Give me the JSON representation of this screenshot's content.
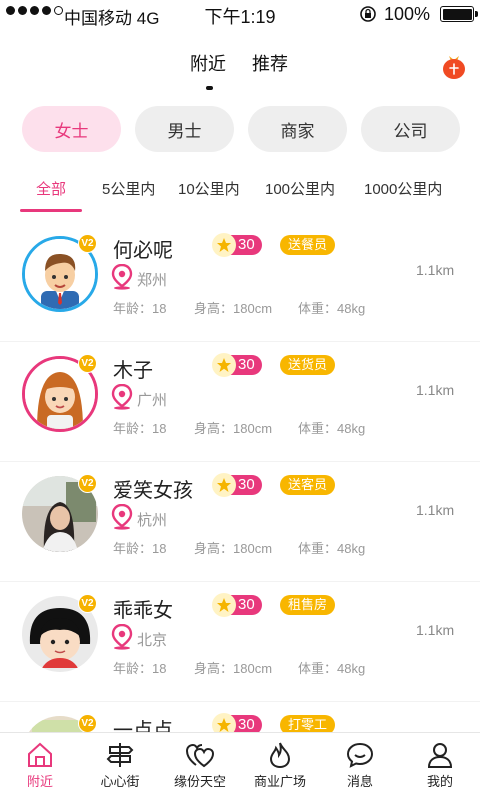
{
  "status_bar": {
    "carrier": "中国移动",
    "network": "4G",
    "time": "下午1:19",
    "battery": "100%",
    "signal_level": 4
  },
  "top_nav": {
    "tabs": [
      {
        "label": "附近",
        "active": true
      },
      {
        "label": "推荐",
        "active": false
      }
    ],
    "action_icon": "red-envelope-bag-icon"
  },
  "gender_filter": [
    {
      "label": "女士",
      "active": true
    },
    {
      "label": "男士",
      "active": false
    },
    {
      "label": "商家",
      "active": false
    },
    {
      "label": "公司",
      "active": false
    }
  ],
  "distance_filter": [
    {
      "label": "全部",
      "active": true
    },
    {
      "label": "5公里内",
      "active": false
    },
    {
      "label": "10公里内",
      "active": false
    },
    {
      "label": "100公里内",
      "active": false
    },
    {
      "label": "1000公里内",
      "active": false
    }
  ],
  "meta_labels": {
    "age": "年龄：",
    "height": "身高：",
    "weight": "体重："
  },
  "users": [
    {
      "name": "何必呢",
      "level": "V2",
      "score": "30",
      "job": "送餐员",
      "city": "郑州",
      "age": "18",
      "height": "180cm",
      "weight": "48kg",
      "distance": "1.1km",
      "avatar": "cartoon-man-avatar"
    },
    {
      "name": "木子",
      "level": "V2",
      "score": "30",
      "job": "送货员",
      "city": "广州",
      "age": "18",
      "height": "180cm",
      "weight": "48kg",
      "distance": "1.1km",
      "avatar": "cartoon-girl-avatar"
    },
    {
      "name": "爱笑女孩",
      "level": "V2",
      "score": "30",
      "job": "送客员",
      "city": "杭州",
      "age": "18",
      "height": "180cm",
      "weight": "48kg",
      "distance": "1.1km",
      "avatar": "photo-girl-avatar"
    },
    {
      "name": "乖乖女",
      "level": "V2",
      "score": "30",
      "job": "租售房",
      "city": "北京",
      "age": "18",
      "height": "180cm",
      "weight": "48kg",
      "distance": "1.1km",
      "avatar": "maruko-avatar"
    },
    {
      "name": "一点点",
      "level": "V2",
      "score": "30",
      "job": "打零工",
      "city": "",
      "age": "",
      "height": "",
      "weight": "",
      "distance": "",
      "avatar": "partial-avatar"
    }
  ],
  "tab_bar": [
    {
      "label": "附近",
      "icon": "home-icon",
      "active": true
    },
    {
      "label": "心心街",
      "icon": "signpost-icon",
      "active": false
    },
    {
      "label": "缘份天空",
      "icon": "hearts-icon",
      "active": false
    },
    {
      "label": "商业广场",
      "icon": "flame-icon",
      "active": false
    },
    {
      "label": "消息",
      "icon": "chat-bubble-icon",
      "active": false
    },
    {
      "label": "我的",
      "icon": "user-icon",
      "active": false
    }
  ],
  "colors": {
    "accent": "#e8387c",
    "badge_yellow": "#f8b600",
    "ring_blue": "#28a9e8"
  }
}
